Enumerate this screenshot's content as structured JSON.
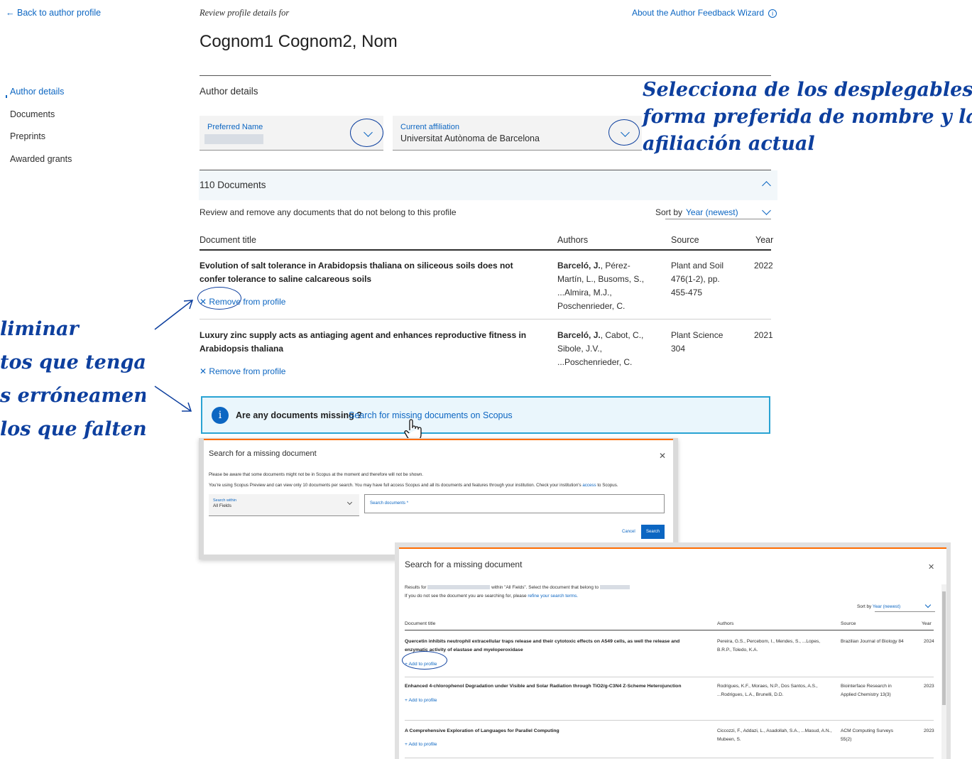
{
  "nav": {
    "back_label": "Back to author profile",
    "items": [
      {
        "label": "Author details"
      },
      {
        "label": "Documents"
      },
      {
        "label": "Preprints"
      },
      {
        "label": "Awarded grants"
      }
    ]
  },
  "header": {
    "review_label": "Review profile details for",
    "about_link": "About the Author Feedback Wizard",
    "author_name": "Cognom1 Cognom2, Nom"
  },
  "author_details": {
    "title": "Author details",
    "preferred_name_label": "Preferred Name",
    "affiliation_label": "Current affiliation",
    "affiliation_value": "Universitat Autònoma de Barcelona"
  },
  "documents": {
    "count_label": "110 Documents",
    "review_text": "Review and remove any documents that do not belong to this profile",
    "sort_label": "Sort by",
    "sort_value": "Year (newest)",
    "columns": {
      "title": "Document title",
      "authors": "Authors",
      "source": "Source",
      "year": "Year"
    },
    "rows": [
      {
        "title": "Evolution of salt tolerance in Arabidopsis thaliana on siliceous soils does not confer tolerance to saline calcareous soils",
        "authors_bold": "Barceló, J.",
        "authors_rest": ", Pérez-Martín, L., Busoms, S., ...Almira, M.J., Poschenrieder, C.",
        "source": "Plant and Soil 476(1-2), pp. 455-475",
        "year": "2022",
        "action": "Remove from profile"
      },
      {
        "title": "Luxury zinc supply acts as antiaging agent and enhances reproductive fitness in Arabidopsis thaliana",
        "authors_bold": "Barceló, J.",
        "authors_rest": ", Cabot, C., Sibole, J.V., ...Poschenrieder, C.",
        "source": "Plant Science 304",
        "year": "2021",
        "action": "Remove from profile"
      }
    ],
    "missing_question": "Are any documents missing ?",
    "missing_link": "Search for missing documents on Scopus"
  },
  "search_modal": {
    "title": "Search for a missing document",
    "notice": "Please be aware that some documents might not be in Scopus at the moment and therefore will not be shown.",
    "preview_text_before": "You're using Scopus Preview and can view only 10 documents per search. You may have full access Scopus and all its documents and features through your institution. Check your institution's",
    "preview_link": "access",
    "preview_text_after": "to Scopus.",
    "search_within_label": "Search within",
    "search_within_value": "All Fields",
    "search_input_placeholder": "Search documents *",
    "cancel_label": "Cancel",
    "search_label": "Search"
  },
  "results_modal": {
    "title": "Search for a missing document",
    "results_for": "Results for",
    "within_text": "within \"All Fields\". Select the document that belong to",
    "refine_before": "If you do not see the document you are searching for, please",
    "refine_link": "refine your search terms.",
    "sort_label": "Sort by",
    "sort_value": "Year (newest)",
    "columns": {
      "title": "Document title",
      "authors": "Authors",
      "source": "Source",
      "year": "Year"
    },
    "rows": [
      {
        "title": "Quercetin inhibits neutrophil extracellular traps release and their cytotoxic effects on A549 cells, as well the release and enzymatic activity of elastase and myeloperoxidase",
        "authors": "Pereira, G.S., Percebom, I., Mendes, S., ...Lopes, B.R.P., Toledo, K.A.",
        "source": "Brazilian Journal of Biology 84",
        "year": "2024",
        "action": "Add to profile"
      },
      {
        "title": "Enhanced 4-chlorophenol Degradation under Visible and Solar Radiation through TiO2/g-C3N4 Z-Scheme Heterojunction",
        "authors": "Rodrigues, K.F., Moraes, N.P., Dos Santos, A.S., ...Rodrigues, L.A., Brunelli, D.D.",
        "source": "Biointerface Research in Applied Chemistry 13(3)",
        "year": "2023",
        "action": "Add to profile"
      },
      {
        "title": "A Comprehensive Exploration of Languages for Parallel Computing",
        "authors": "Ciccozzi, F., Addazi, L., Asadollah, S.A., ...Masud, A.N., Mubeen, S.",
        "source": "ACM Computing Surveys 55(2)",
        "year": "2023",
        "action": "Add to profile"
      }
    ]
  },
  "annotations": {
    "right_lines": [
      "Selecciona de los desplegables la",
      "forma  preferida de nombre y la",
      "afiliación actual"
    ],
    "left_lines": [
      "liminar",
      "tos que tengas",
      "s erróneamente",
      "los que falten."
    ]
  },
  "colors": {
    "accent": "#0c66c2",
    "annotation": "#0d3f9e",
    "modal_bar": "#ff6c00"
  },
  "icons": [
    "arrow-left-icon",
    "info-icon",
    "chevron-down-icon",
    "chevron-up-icon",
    "close-icon",
    "plus-icon",
    "hand-cursor-icon"
  ]
}
